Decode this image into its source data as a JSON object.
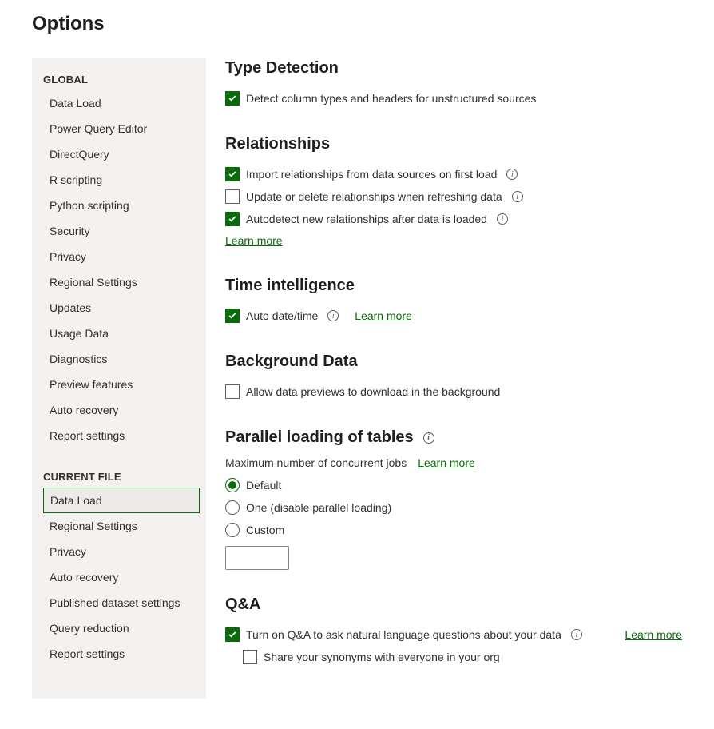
{
  "title": "Options",
  "sidebar": {
    "global_header": "GLOBAL",
    "global_items": [
      "Data Load",
      "Power Query Editor",
      "DirectQuery",
      "R scripting",
      "Python scripting",
      "Security",
      "Privacy",
      "Regional Settings",
      "Updates",
      "Usage Data",
      "Diagnostics",
      "Preview features",
      "Auto recovery",
      "Report settings"
    ],
    "current_header": "CURRENT FILE",
    "current_items": [
      "Data Load",
      "Regional Settings",
      "Privacy",
      "Auto recovery",
      "Published dataset settings",
      "Query reduction",
      "Report settings"
    ],
    "selected": "Data Load"
  },
  "sections": {
    "type_detection": {
      "title": "Type Detection",
      "opt1": {
        "label": "Detect column types and headers for unstructured sources",
        "checked": true
      }
    },
    "relationships": {
      "title": "Relationships",
      "opt1": {
        "label": "Import relationships from data sources on first load",
        "checked": true
      },
      "opt2": {
        "label": "Update or delete relationships when refreshing data",
        "checked": false
      },
      "opt3": {
        "label": "Autodetect new relationships after data is loaded",
        "checked": true
      },
      "learn_more": "Learn more"
    },
    "time_intelligence": {
      "title": "Time intelligence",
      "opt1": {
        "label": "Auto date/time",
        "checked": true
      },
      "learn_more": "Learn more"
    },
    "background_data": {
      "title": "Background Data",
      "opt1": {
        "label": "Allow data previews to download in the background",
        "checked": false
      }
    },
    "parallel": {
      "title": "Parallel loading of tables",
      "subtext": "Maximum number of concurrent jobs",
      "learn_more": "Learn more",
      "radios": {
        "default": "Default",
        "one": "One (disable parallel loading)",
        "custom": "Custom"
      },
      "selected": "default",
      "custom_value": ""
    },
    "qa": {
      "title": "Q&A",
      "opt1": {
        "label": "Turn on Q&A to ask natural language questions about your data",
        "checked": true
      },
      "opt2": {
        "label": "Share your synonyms with everyone in your org",
        "checked": false
      },
      "learn_more": "Learn more"
    }
  }
}
